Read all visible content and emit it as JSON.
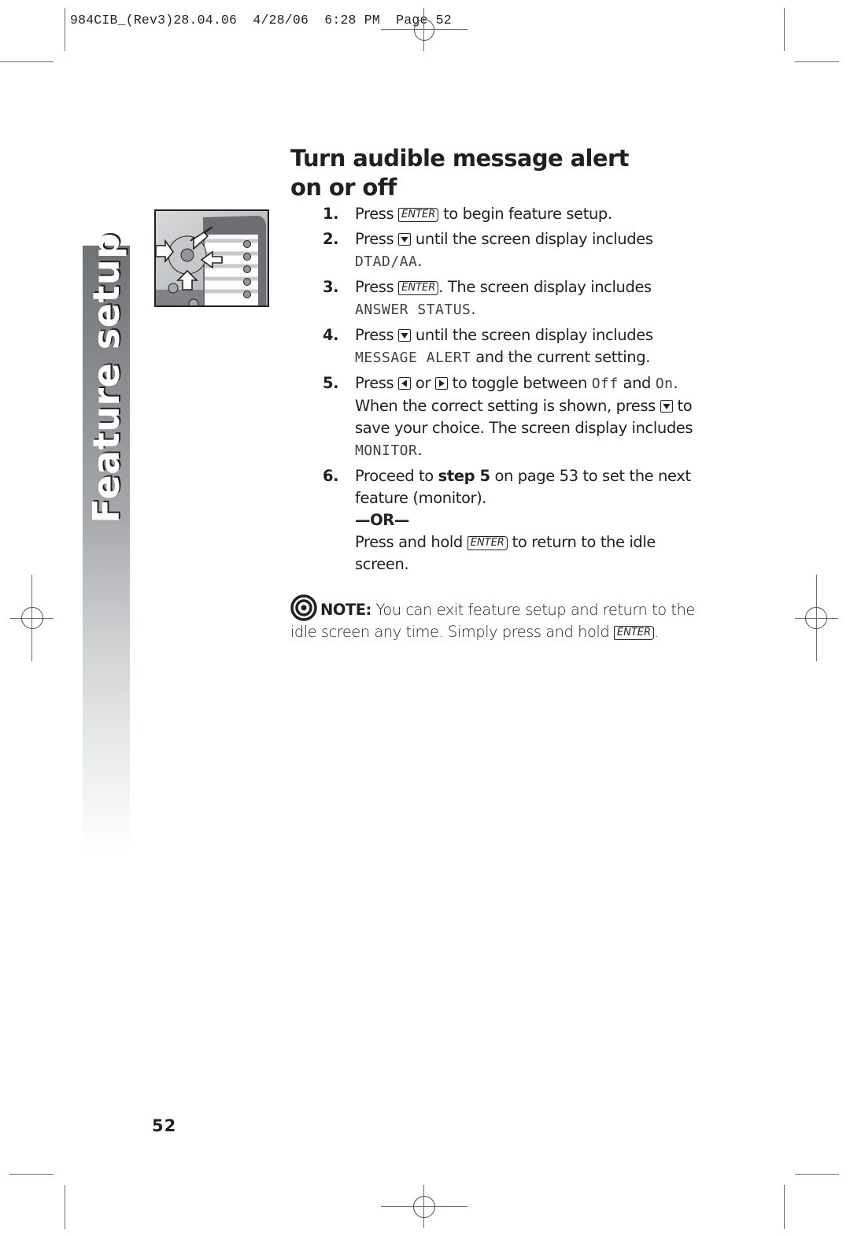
{
  "print_slug": "984CIB_(Rev3)28.04.06  4/28/06  6:28 PM  Page 52",
  "side_tab": {
    "label": "Feature setup"
  },
  "illustration": {
    "description": "handset navigation keys with ENTER and arrow keys highlighted"
  },
  "section": {
    "title_line1": "Turn audible message alert",
    "title_line2": "on or off"
  },
  "steps": [
    {
      "number": "1.",
      "parts": {
        "a": "Press ",
        "key": "ENTER",
        "b": " to begin feature setup."
      }
    },
    {
      "number": "2.",
      "parts": {
        "a": "Press ",
        "b": " until the screen display includes",
        "lcd": "DTAD/AA",
        "c": "."
      }
    },
    {
      "number": "3.",
      "parts": {
        "a": "Press ",
        "key": "ENTER",
        "b": ". The screen display includes",
        "lcd": "ANSWER STATUS",
        "c": "."
      }
    },
    {
      "number": "4.",
      "parts": {
        "a": "Press ",
        "b": " until the screen display includes",
        "lcd": "MESSAGE ALERT",
        "c": " and the current setting."
      }
    },
    {
      "number": "5.",
      "parts": {
        "a": "Press ",
        "or": " or ",
        "b": " to toggle between ",
        "lcd_off": "Off",
        "and": " and ",
        "lcd_on": "On",
        "c": ".",
        "d": "When the correct setting is shown, press ",
        "e": " to",
        "f": "save your choice. The screen display includes",
        "lcd": "MONITOR",
        "g": "."
      }
    },
    {
      "number": "6.",
      "parts": {
        "a": "Proceed to ",
        "bold": "step 5",
        "b": " on page 53 to set the next",
        "c": "feature (monitor).",
        "or_sep": "—OR—",
        "d": "Press and hold ",
        "key": "ENTER",
        "e": " to return to the idle",
        "f": "screen."
      }
    }
  ],
  "note": {
    "label": "NOTE:",
    "text1": " You can exit feature setup and return to the",
    "text2": "idle screen any time.  Simply press and hold ",
    "key": "ENTER",
    "end": "."
  },
  "page_number": "52"
}
